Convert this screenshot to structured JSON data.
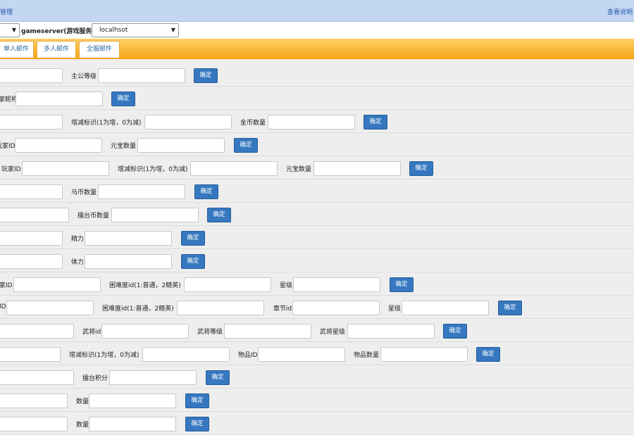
{
  "header": {
    "title": "管理",
    "help_link": "查看说明"
  },
  "server_bar": {
    "label": "gameserver(游戏服务器)",
    "server_value": "localhsot"
  },
  "tabs": [
    {
      "label": "单人邮件"
    },
    {
      "label": "多人邮件"
    },
    {
      "label": "全服邮件"
    }
  ],
  "confirm_label": "确定",
  "rows": [
    {
      "labels": [
        "主公等级"
      ]
    },
    {
      "labels": [
        "家昵称"
      ]
    },
    {
      "labels": [
        "增减标识(1为增，0为减)",
        "金币数量"
      ]
    },
    {
      "labels": [
        "玩家ID",
        "元宝数量"
      ]
    },
    {
      "labels": [
        "玩家ID",
        "增减标识(1为增，0为减)",
        "元宝数量"
      ]
    },
    {
      "labels": [
        "马币数量"
      ]
    },
    {
      "labels": [
        "擂台币数量"
      ]
    },
    {
      "labels": [
        "精力"
      ]
    },
    {
      "labels": [
        "体力"
      ]
    },
    {
      "labels": [
        "家ID",
        "困难度id(1:普通，2精英)",
        "星级"
      ]
    },
    {
      "labels": [
        "ID",
        "困难度id(1:普通，2精英)",
        "章节id",
        "星级"
      ]
    },
    {
      "labels": [
        "武将id",
        "武将等级",
        "武将星级"
      ]
    },
    {
      "labels": [
        "增减标识(1为增，0为减)",
        "物品ID",
        "物品数量"
      ]
    },
    {
      "labels": [
        "擂台积分"
      ]
    },
    {
      "labels": [
        "数量"
      ]
    },
    {
      "labels": [
        "数量"
      ]
    }
  ]
}
